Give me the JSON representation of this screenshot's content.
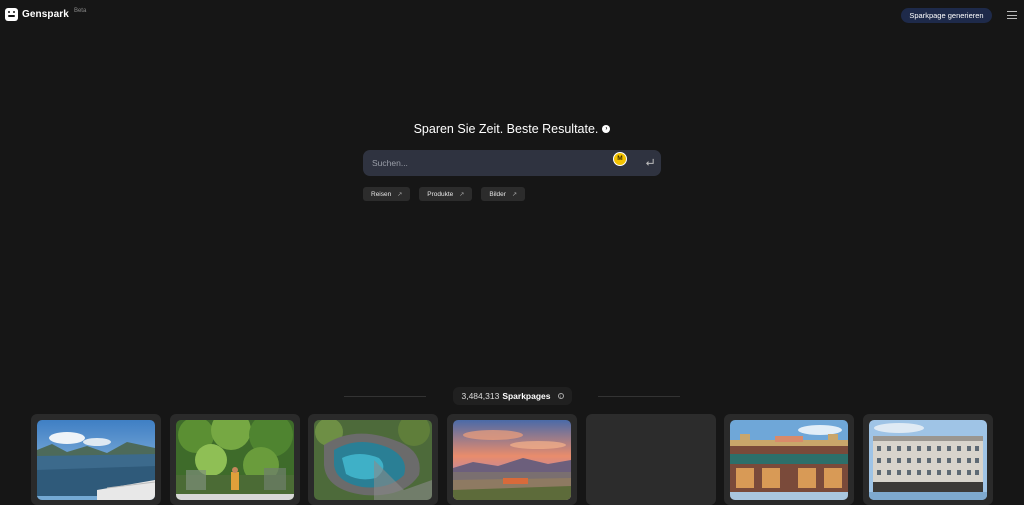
{
  "header": {
    "brand": "Genspark",
    "beta_label": "Beta",
    "generate_button": "Sparkpage generieren"
  },
  "hero": {
    "tagline": "Sparen Sie Zeit. Beste Resultate.",
    "search_placeholder": "Suchen...",
    "avatar_initial": "M"
  },
  "chips": [
    {
      "label": "Reisen"
    },
    {
      "label": "Produkte"
    },
    {
      "label": "Bilder"
    }
  ],
  "counter": {
    "count": "3,484,313",
    "label": "Sparkpages"
  },
  "icons": {
    "menu": "hamburger-icon",
    "submit": "enter-icon",
    "chip": "arrow-up-right-icon",
    "info": "info-icon"
  },
  "colors": {
    "background": "#161616",
    "search_box": "#2f3340",
    "accent_button": "#1e2a4a",
    "avatar": "#f2c200"
  }
}
